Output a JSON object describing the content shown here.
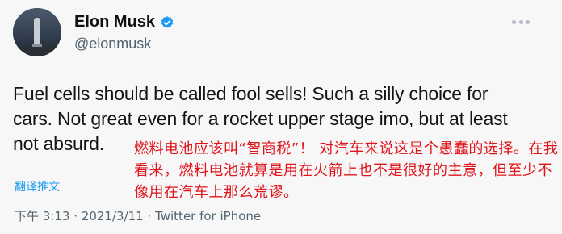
{
  "tweet": {
    "display_name": "Elon Musk",
    "handle": "@elonmusk",
    "text_lines": [
      "Fuel cells should be called fool sells! Such a silly choice for",
      "cars. Not great even for a rocket upper stage imo, but at least",
      "not absurd."
    ],
    "translate_label": "翻译推文",
    "time": "下午 3:13",
    "separator": "·",
    "date": "2021/3/11",
    "source": "Twitter for iPhone"
  },
  "annotation": {
    "text": "燃料电池应该叫“智商税”！ 对汽车来说这是个愚蠢的选择。在我看来，燃料电池就算是用在火箭上也不是很好的主意，但至少不像用在汽车上那么荒谬。"
  },
  "colors": {
    "annotation": "#e0141b",
    "link": "#1d9bf0",
    "verified": "#1d9bf0"
  }
}
